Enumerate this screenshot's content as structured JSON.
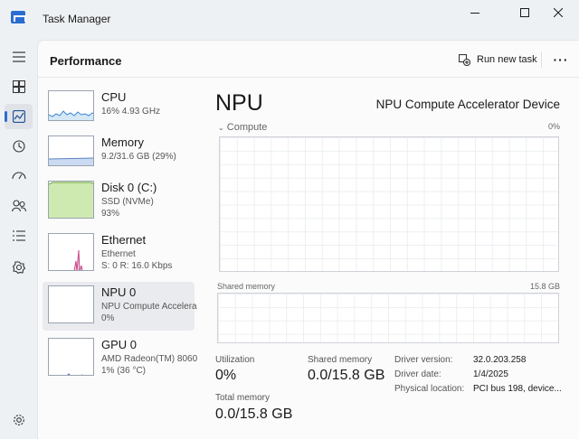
{
  "window": {
    "title": "Task Manager"
  },
  "header": {
    "title": "Performance",
    "run_new_task": "Run new task",
    "more": "···"
  },
  "nav": [
    "hamburger-menu",
    "processes",
    "performance",
    "app-history",
    "startup-apps",
    "users",
    "details",
    "services",
    "settings"
  ],
  "devices": [
    {
      "name": "CPU",
      "lines": [
        "16% 4.93 GHz"
      ],
      "graph_color": "#3a86d0",
      "fill": "#d4e8f8"
    },
    {
      "name": "Memory",
      "lines": [
        "9.2/31.6 GB (29%)"
      ],
      "graph_color": "#5a84c4",
      "fill": "#c9daf2"
    },
    {
      "name": "Disk 0 (C:)",
      "lines": [
        "SSD (NVMe)",
        "93%"
      ],
      "graph_color": "#6aa53a",
      "fill": "#cfeab0"
    },
    {
      "name": "Ethernet",
      "lines": [
        "Ethernet",
        "S: 0 R: 16.0 Kbps"
      ],
      "graph_color": "#c8478a",
      "fill": "#f3d3e4"
    },
    {
      "name": "NPU 0",
      "lines": [
        "NPU Compute Accelera...",
        "0%"
      ],
      "graph_color": "#9aa4b0",
      "fill": "#ffffff"
    },
    {
      "name": "GPU 0",
      "lines": [
        "AMD Radeon(TM) 8060S",
        "1% (36 °C)"
      ],
      "graph_color": "#7a5ac8",
      "fill": "#e6ddf7"
    }
  ],
  "detail": {
    "title": "NPU",
    "device_name": "NPU Compute Accelerator Device",
    "compute_label": "Compute",
    "compute_pct": "0%",
    "shared_memory_label": "Shared memory",
    "shared_memory_max": "15.8 GB",
    "utilization_label": "Utilization",
    "utilization_value": "0%",
    "shared_memory_stat_label": "Shared memory",
    "shared_memory_stat_value": "0.0/15.8 GB",
    "total_memory_label": "Total memory",
    "total_memory_value": "0.0/15.8 GB",
    "info": [
      {
        "label": "Driver version:",
        "value": "32.0.203.258"
      },
      {
        "label": "Driver date:",
        "value": "1/4/2025"
      },
      {
        "label": "Physical location:",
        "value": "PCI bus 198, device..."
      }
    ]
  }
}
